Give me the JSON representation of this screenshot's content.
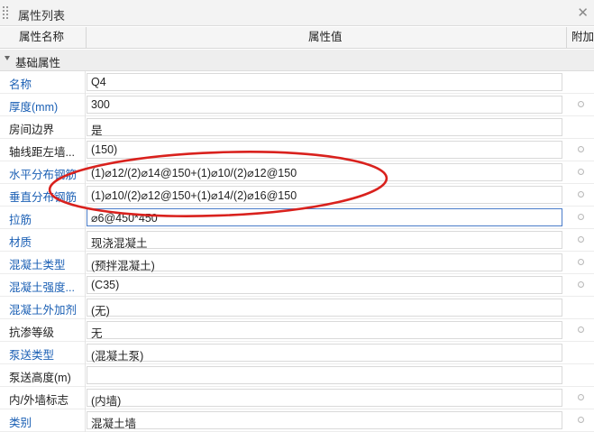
{
  "panel": {
    "title": "属性列表"
  },
  "columns": {
    "name": "属性名称",
    "value": "属性值",
    "extra": "附加"
  },
  "group": {
    "label": "基础属性"
  },
  "rows": [
    {
      "name": "名称",
      "value": "Q4",
      "blue": true,
      "radio": false
    },
    {
      "name": "厚度(mm)",
      "value": "300",
      "blue": true,
      "radio": true
    },
    {
      "name": "房间边界",
      "value": "是",
      "blue": false,
      "radio": false
    },
    {
      "name": "轴线距左墙...",
      "value": "(150)",
      "blue": false,
      "radio": true
    },
    {
      "name": "水平分布钢筋",
      "value": "(1)⌀12/(2)⌀14@150+(1)⌀10/(2)⌀12@150",
      "blue": true,
      "radio": true
    },
    {
      "name": "垂直分布钢筋",
      "value": "(1)⌀10/(2)⌀12@150+(1)⌀14/(2)⌀16@150",
      "blue": true,
      "radio": true
    },
    {
      "name": "拉筋",
      "value": "⌀6@450*450",
      "blue": true,
      "radio": true
    },
    {
      "name": "材质",
      "value": "现浇混凝土",
      "blue": true,
      "radio": true
    },
    {
      "name": "混凝土类型",
      "value": "(预拌混凝土)",
      "blue": true,
      "radio": true
    },
    {
      "name": "混凝土强度...",
      "value": "(C35)",
      "blue": true,
      "radio": true
    },
    {
      "name": "混凝土外加剂",
      "value": "(无)",
      "blue": true,
      "radio": false
    },
    {
      "name": "抗渗等级",
      "value": "无",
      "blue": false,
      "radio": true
    },
    {
      "name": "泵送类型",
      "value": "(混凝土泵)",
      "blue": true,
      "radio": false
    },
    {
      "name": "泵送高度(m)",
      "value": "",
      "blue": false,
      "radio": false
    },
    {
      "name": "内/外墙标志",
      "value": "(内墙)",
      "blue": false,
      "radio": true
    },
    {
      "name": "类别",
      "value": "混凝土墙",
      "blue": true,
      "radio": true
    }
  ],
  "active_row": 6,
  "annotation_color": "#d9211d"
}
